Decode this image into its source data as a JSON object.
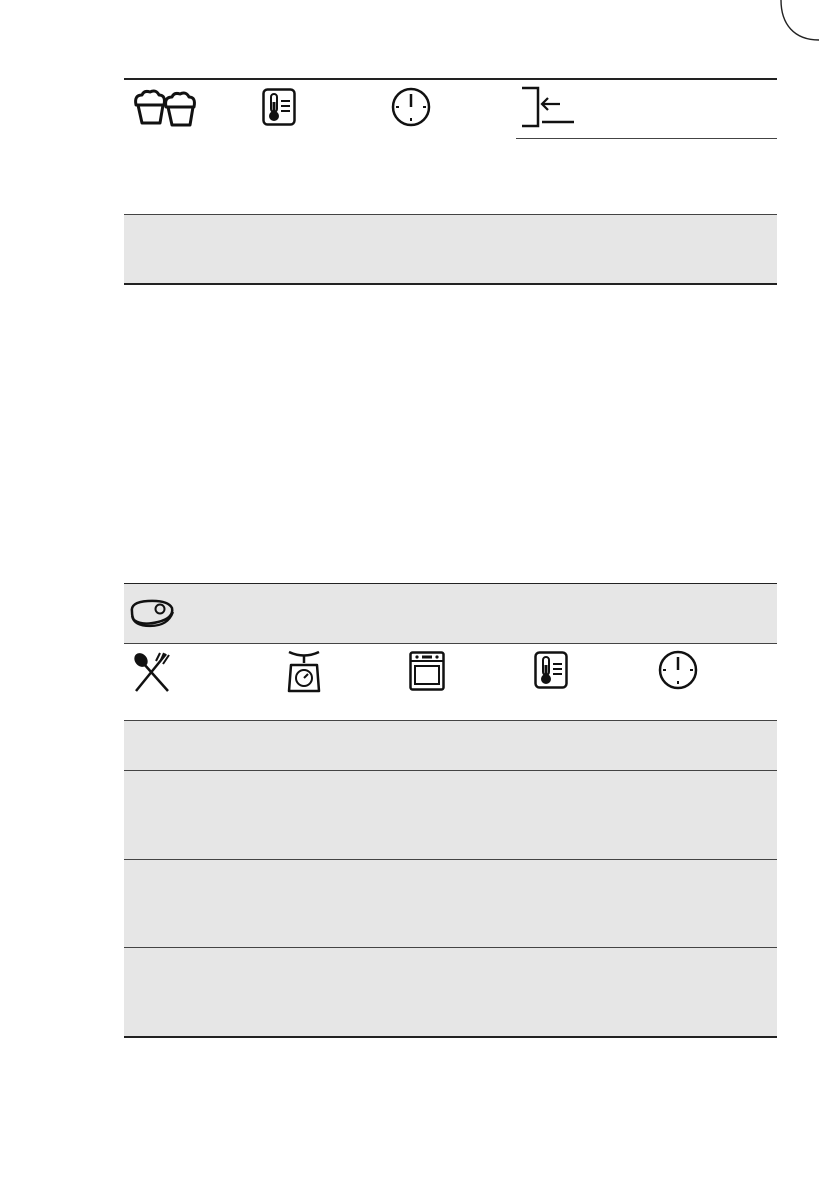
{
  "icons": {
    "table1": [
      "muffins-icon",
      "thermometer-icon",
      "clock-icon",
      "shelf-position-icon"
    ],
    "table2_header": [
      "steak-icon"
    ],
    "table2": [
      "cutlery-icon",
      "kitchen-scale-icon",
      "oven-icon",
      "thermometer-icon",
      "clock-icon"
    ]
  },
  "table1": {
    "rows": [
      {
        "cells": [
          "",
          "",
          "",
          "",
          ""
        ]
      },
      {
        "cells": [
          "",
          "",
          "",
          "",
          ""
        ]
      }
    ]
  },
  "table2": {
    "rows": [
      {
        "cells": [
          "",
          "",
          "",
          "",
          ""
        ]
      },
      {
        "cells": [
          "",
          "",
          "",
          "",
          ""
        ]
      },
      {
        "cells": [
          "",
          "",
          "",
          "",
          ""
        ]
      },
      {
        "cells": [
          "",
          "",
          "",
          "",
          ""
        ]
      }
    ]
  },
  "colors": {
    "band": "#e6e6e6",
    "rule": "#222222"
  }
}
